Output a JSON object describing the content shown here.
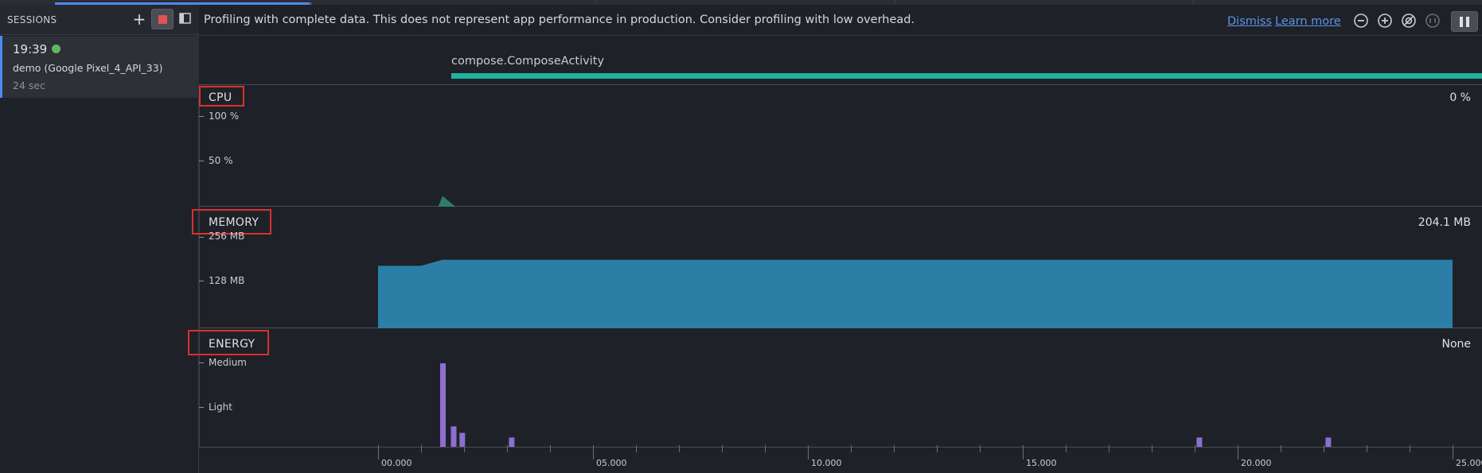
{
  "sidebar": {
    "title": "SESSIONS",
    "add_icon": "plus-icon",
    "stop_icon": "stop-icon",
    "panel_icon": "panel-toggle-icon",
    "session": {
      "time": "19:39",
      "status_color": "#5fb85f",
      "device": "demo (Google Pixel_4_API_33)",
      "duration": "24 sec"
    }
  },
  "banner": {
    "message": "Profiling with complete data. This does not represent app performance in production. Consider profiling with low overhead.",
    "dismiss": "Dismiss",
    "learn_more": "Learn more",
    "zoom_out_icon": "zoom-out-icon",
    "zoom_in_icon": "zoom-in-icon",
    "reset_zoom_icon": "reset-zoom-icon",
    "fit_icon": "zoom-to-selection-icon",
    "pause_icon": "pause-icon"
  },
  "activity": {
    "label": "compose.ComposeActivity",
    "color": "#1fb3a0"
  },
  "tracks": {
    "cpu": {
      "label": "CPU",
      "value": "0 %",
      "ticks": [
        "100 %",
        "50 %"
      ]
    },
    "memory": {
      "label": "MEMORY",
      "value": "204.1 MB",
      "ticks": [
        "256 MB",
        "128 MB"
      ],
      "color": "#2b7fa6"
    },
    "energy": {
      "label": "ENERGY",
      "value": "None",
      "ticks": [
        "Medium",
        "Light"
      ],
      "color": "#8c6fd0"
    }
  },
  "timeline": {
    "labels": [
      "00.000",
      "05.000",
      "10.000",
      "15.000",
      "20.000",
      "25.000"
    ]
  },
  "chart_data": [
    {
      "type": "area",
      "name": "cpu",
      "x": [
        1.4,
        1.5,
        1.8
      ],
      "y": [
        0,
        12,
        0
      ],
      "ylim": [
        0,
        100
      ]
    },
    {
      "type": "area",
      "name": "memory",
      "x": [
        0.0,
        1.0,
        1.5,
        25.0
      ],
      "y": [
        175,
        175,
        192,
        192
      ],
      "ylim": [
        0,
        256
      ]
    },
    {
      "type": "bar",
      "name": "energy",
      "x": [
        1.5,
        1.75,
        1.95,
        3.1,
        19.1,
        22.1
      ],
      "y": [
        0.9,
        0.22,
        0.15,
        0.1,
        0.1,
        0.1
      ],
      "ylim": [
        0,
        2
      ]
    }
  ]
}
